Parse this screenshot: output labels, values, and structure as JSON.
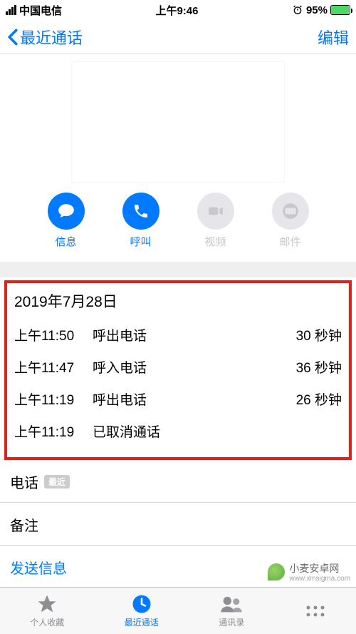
{
  "status": {
    "carrier": "中国电信",
    "time": "上午9:46",
    "battery_pct": "95%"
  },
  "nav": {
    "back_label": "最近通话",
    "edit_label": "编辑"
  },
  "actions": {
    "message": "信息",
    "call": "呼叫",
    "video": "视频",
    "mail": "邮件"
  },
  "call_log": {
    "date": "2019年7月28日",
    "rows": [
      {
        "time": "上午11:50",
        "type": "呼出电话",
        "duration": "30 秒钟"
      },
      {
        "time": "上午11:47",
        "type": "呼入电话",
        "duration": "36 秒钟"
      },
      {
        "time": "上午11:19",
        "type": "呼出电话",
        "duration": "26 秒钟"
      },
      {
        "time": "上午11:19",
        "type": "已取消通话",
        "duration": ""
      }
    ]
  },
  "sections": {
    "phone_label": "电话",
    "recent_badge": "最近",
    "notes_label": "备注",
    "send_message": "发送信息"
  },
  "tabs": {
    "favorites": "个人收藏",
    "recents": "最近通话",
    "contacts": "通讯录"
  },
  "watermark": {
    "brand": "小麦安卓网",
    "url": "www.xmsigma.com"
  }
}
